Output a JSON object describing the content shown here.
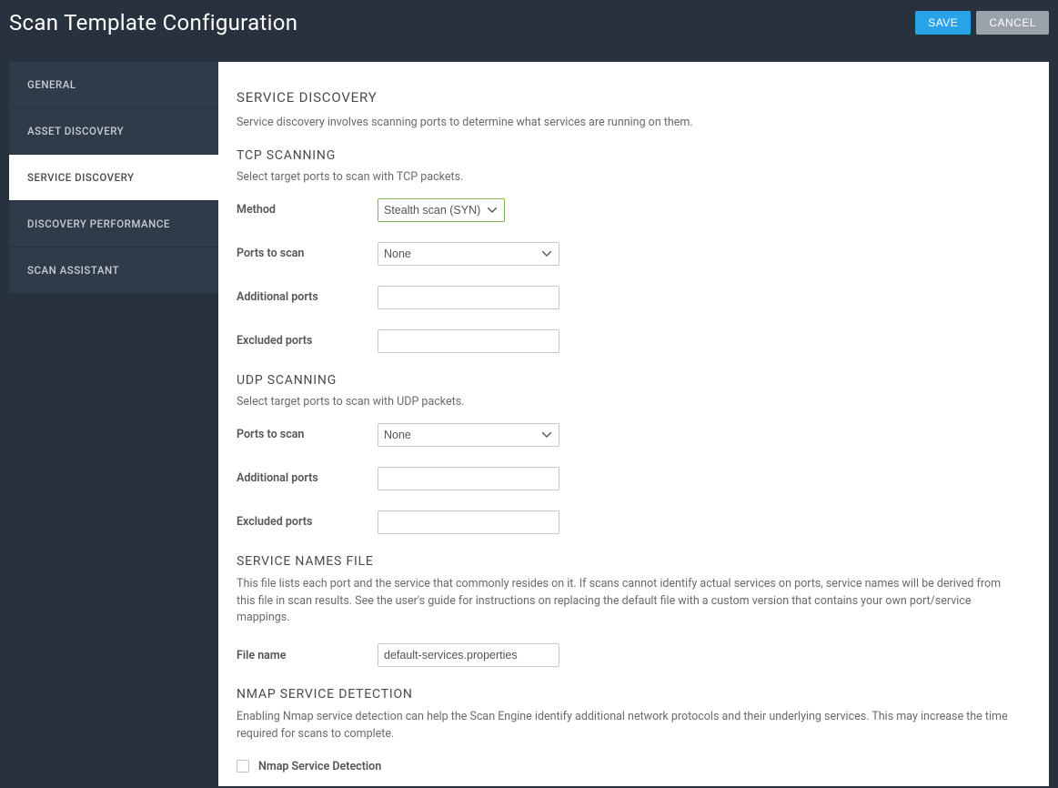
{
  "header": {
    "title": "Scan Template Configuration",
    "save_label": "SAVE",
    "cancel_label": "CANCEL"
  },
  "sidebar": {
    "items": [
      {
        "label": "GENERAL",
        "active": false
      },
      {
        "label": "ASSET DISCOVERY",
        "active": false
      },
      {
        "label": "SERVICE DISCOVERY",
        "active": true
      },
      {
        "label": "DISCOVERY PERFORMANCE",
        "active": false
      },
      {
        "label": "SCAN ASSISTANT",
        "active": false
      }
    ]
  },
  "main": {
    "service_discovery": {
      "title": "SERVICE DISCOVERY",
      "desc": "Service discovery involves scanning ports to determine what services are running on them."
    },
    "tcp": {
      "title": "TCP SCANNING",
      "desc": "Select target ports to scan with TCP packets.",
      "method_label": "Method",
      "method_value": "Stealth scan (SYN)",
      "ports_to_scan_label": "Ports to scan",
      "ports_to_scan_value": "None",
      "additional_ports_label": "Additional ports",
      "additional_ports_value": "",
      "excluded_ports_label": "Excluded ports",
      "excluded_ports_value": ""
    },
    "udp": {
      "title": "UDP SCANNING",
      "desc": "Select target ports to scan with UDP packets.",
      "ports_to_scan_label": "Ports to scan",
      "ports_to_scan_value": "None",
      "additional_ports_label": "Additional ports",
      "additional_ports_value": "",
      "excluded_ports_label": "Excluded ports",
      "excluded_ports_value": ""
    },
    "service_names": {
      "title": "SERVICE NAMES FILE",
      "desc": "This file lists each port and the service that commonly resides on it. If scans cannot identify actual services on ports, service names will be derived from this file in scan results. See the user's guide for instructions on replacing the default file with a custom version that contains your own port/service mappings.",
      "file_name_label": "File name",
      "file_name_value": "default-services.properties"
    },
    "nmap": {
      "title": "NMAP SERVICE DETECTION",
      "desc": "Enabling Nmap service detection can help the Scan Engine identify additional network protocols and their underlying services. This may increase the time required for scans to complete.",
      "checkbox_label": "Nmap Service Detection",
      "checked": false
    }
  }
}
